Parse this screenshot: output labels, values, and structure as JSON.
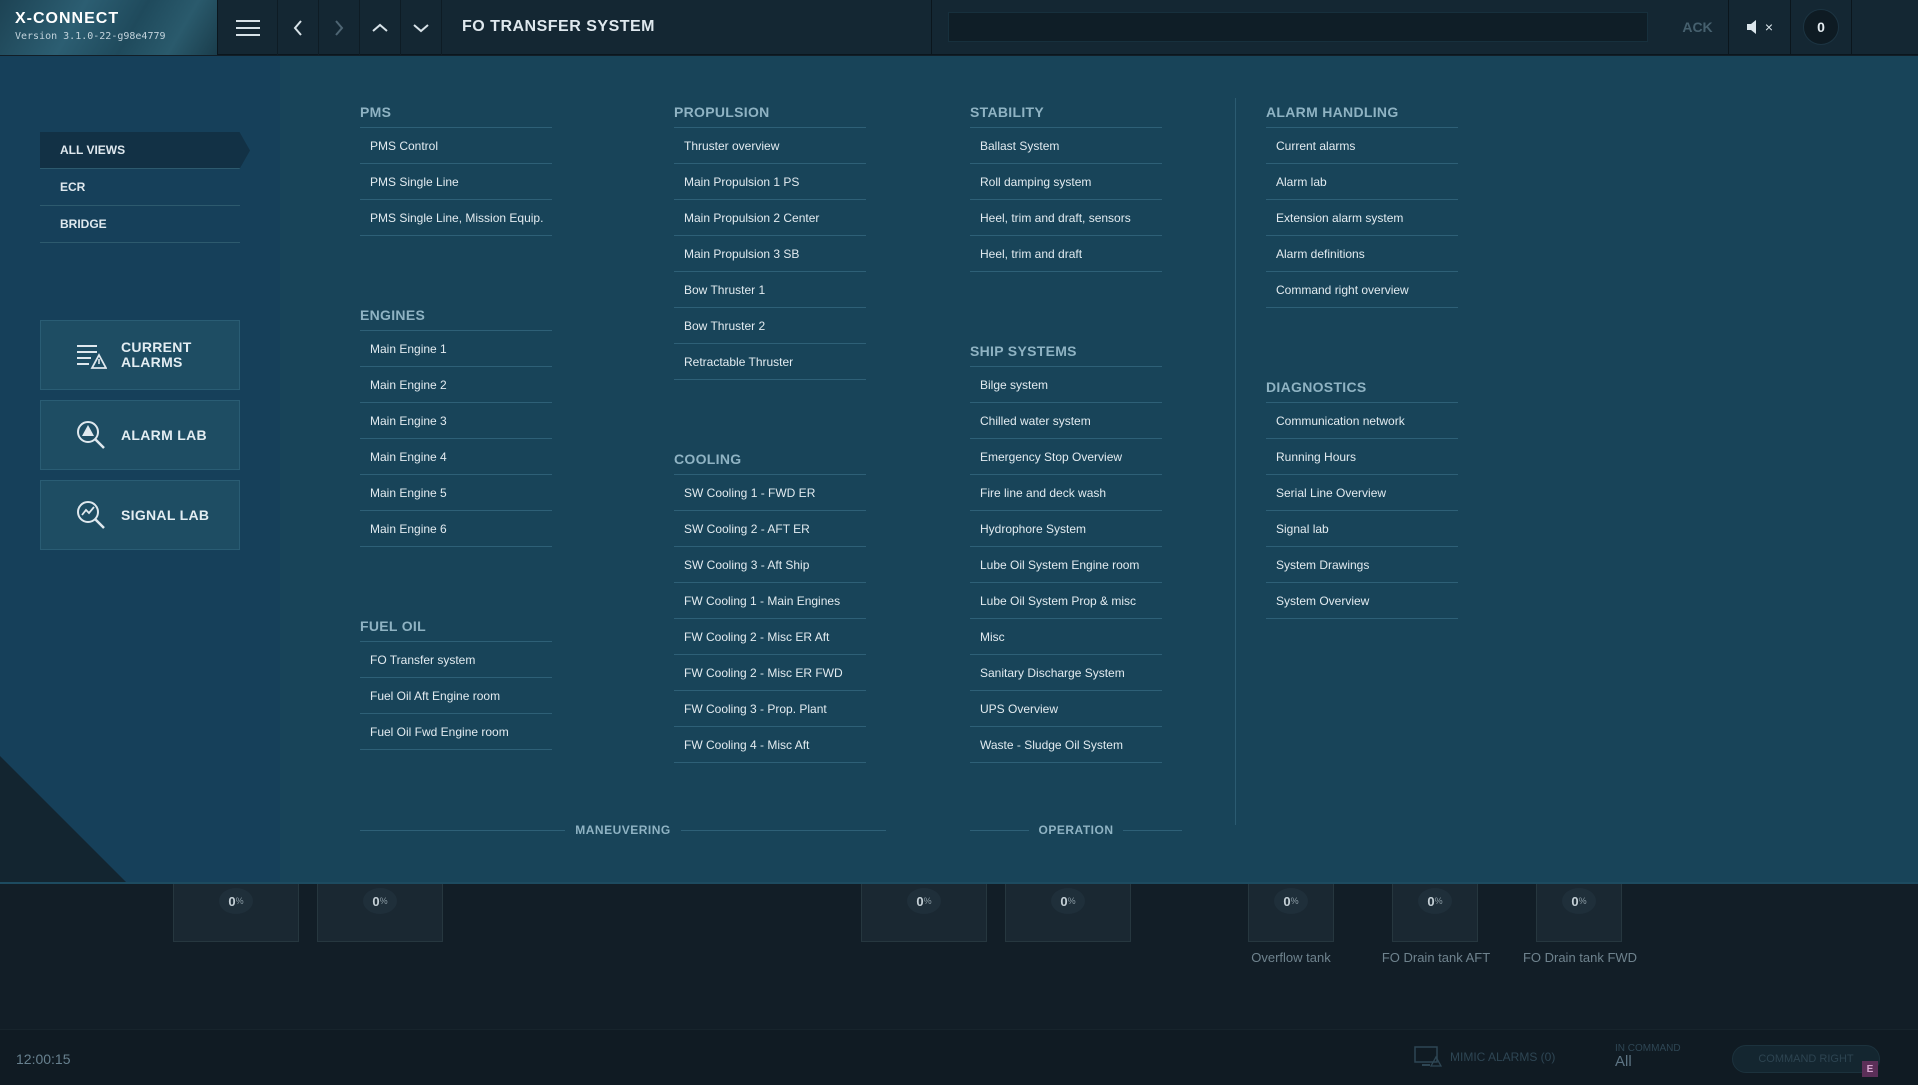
{
  "app": {
    "name": "X-CONNECT",
    "version": "Version 3.1.0-22-g98e4779"
  },
  "topbar": {
    "title": "FO TRANSFER SYSTEM",
    "ack_label": "ACK",
    "mute_x": "×",
    "alarm_count": "0"
  },
  "views": [
    {
      "label": "ALL VIEWS",
      "active": true
    },
    {
      "label": "ECR",
      "active": false
    },
    {
      "label": "BRIDGE",
      "active": false
    }
  ],
  "side_cards": {
    "current_alarms": {
      "line1": "CURRENT",
      "line2": "ALARMS"
    },
    "alarm_lab": "ALARM LAB",
    "signal_lab": "SIGNAL LAB"
  },
  "sections": {
    "pms": {
      "title": "PMS",
      "items": [
        "PMS Control",
        "PMS Single Line",
        "PMS Single Line, Mission Equip."
      ]
    },
    "engines": {
      "title": "ENGINES",
      "items": [
        "Main Engine 1",
        "Main Engine 2",
        "Main Engine 3",
        "Main Engine 4",
        "Main Engine 5",
        "Main Engine 6"
      ]
    },
    "fuel_oil": {
      "title": "FUEL OIL",
      "items": [
        "FO Transfer system",
        "Fuel Oil Aft Engine room",
        "Fuel Oil Fwd Engine room"
      ]
    },
    "propulsion": {
      "title": "PROPULSION",
      "items": [
        "Thruster overview",
        "Main Propulsion 1 PS",
        "Main Propulsion 2 Center",
        "Main Propulsion 3 SB",
        "Bow Thruster 1",
        "Bow Thruster 2",
        "Retractable Thruster"
      ]
    },
    "cooling": {
      "title": "COOLING",
      "items": [
        "SW Cooling 1 - FWD ER",
        "SW Cooling 2 - AFT ER",
        "SW Cooling 3 - Aft Ship",
        "FW Cooling 1 - Main Engines",
        "FW Cooling 2 - Misc ER Aft",
        "FW Cooling 2 - Misc ER FWD",
        "FW Cooling 3 - Prop. Plant",
        "FW Cooling 4 - Misc Aft"
      ]
    },
    "stability": {
      "title": "STABILITY",
      "items": [
        "Ballast System",
        "Roll damping system",
        "Heel, trim and draft, sensors",
        "Heel, trim and draft"
      ]
    },
    "ship_systems": {
      "title": "SHIP SYSTEMS",
      "items": [
        "Bilge system",
        "Chilled water system",
        "Emergency Stop Overview",
        "Fire line and deck wash",
        "Hydrophore System",
        "Lube Oil System Engine room",
        "Lube Oil System Prop & misc",
        "Misc",
        "Sanitary Discharge System",
        "UPS Overview",
        "Waste - Sludge Oil System"
      ]
    },
    "alarm_handling": {
      "title": "ALARM HANDLING",
      "items": [
        "Current alarms",
        "Alarm lab",
        "Extension alarm system",
        "Alarm definitions",
        "Command right overview"
      ]
    },
    "diagnostics": {
      "title": "DIAGNOSTICS",
      "items": [
        "Communication network",
        "Running Hours",
        "Serial Line Overview",
        "Signal lab",
        "System Drawings",
        "System Overview"
      ]
    }
  },
  "groups": {
    "maneuvering": "MANEUVERING",
    "operation": "OPERATION"
  },
  "tanks": [
    {
      "pct": "0",
      "unit": "%",
      "label": ""
    },
    {
      "pct": "0",
      "unit": "%",
      "label": ""
    },
    {
      "pct": "0",
      "unit": "%",
      "label": ""
    },
    {
      "pct": "0",
      "unit": "%",
      "label": ""
    },
    {
      "pct": "0",
      "unit": "%",
      "label": "Overflow tank"
    },
    {
      "pct": "0",
      "unit": "%",
      "label": "FO Drain tank AFT"
    },
    {
      "pct": "0",
      "unit": "%",
      "label": "FO Drain tank FWD"
    }
  ],
  "statusbar": {
    "clock": "12:00:15",
    "mimic_alarms": "MIMIC ALARMS (0)",
    "in_command_label": "IN COMMAND",
    "in_command_value": "All",
    "command_right": "COMMAND RIGHT",
    "badge": "E"
  },
  "colors": {
    "overlay_bg": "#184459",
    "topbar_bg": "#142733",
    "section_head": "#8fb3c3",
    "link_text": "#e2ebf0"
  }
}
